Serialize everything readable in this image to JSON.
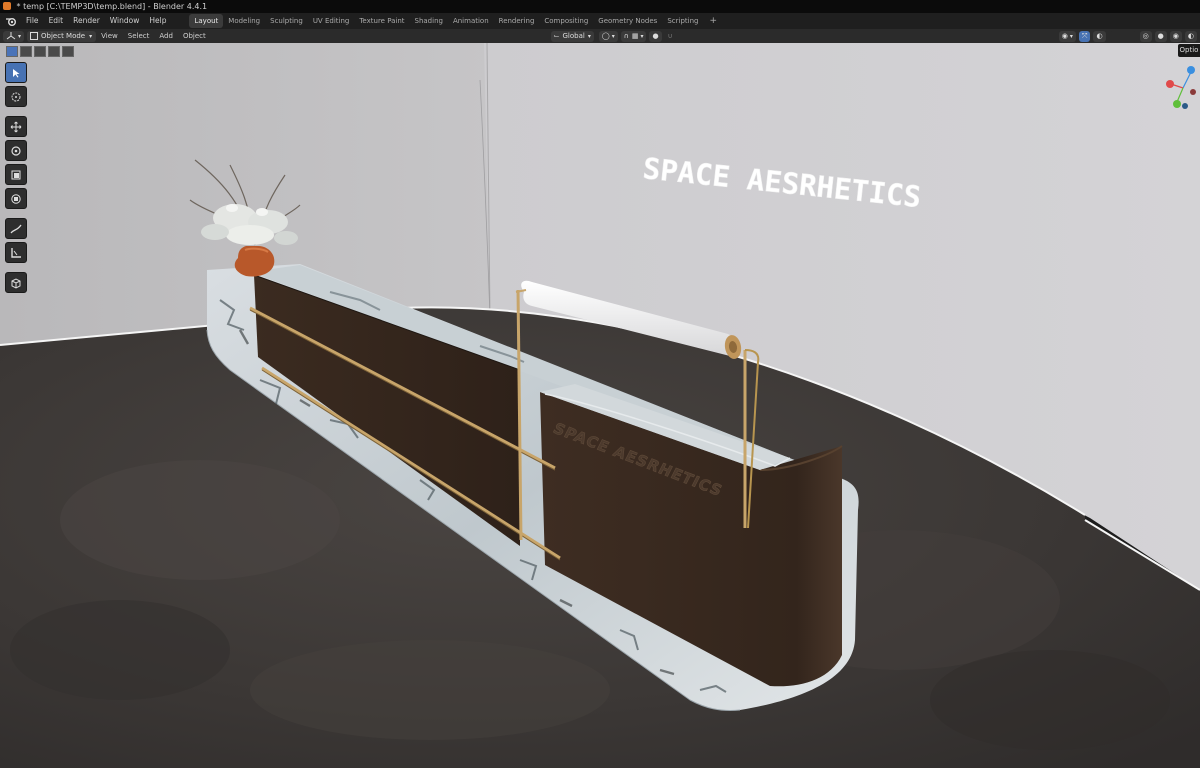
{
  "window": {
    "title": "* temp [C:\\TEMP3D\\temp.blend] - Blender 4.4.1"
  },
  "menu": [
    "File",
    "Edit",
    "Render",
    "Window",
    "Help"
  ],
  "workspaces": [
    "Layout",
    "Modeling",
    "Sculpting",
    "UV Editing",
    "Texture Paint",
    "Shading",
    "Animation",
    "Rendering",
    "Compositing",
    "Geometry Nodes",
    "Scripting"
  ],
  "active_workspace": "Layout",
  "header": {
    "mode": "Object Mode",
    "menus": [
      "View",
      "Select",
      "Add",
      "Object"
    ],
    "transform_orientation": "Global",
    "options_label": "Optio"
  },
  "tools": [
    "select-box",
    "cursor",
    "move",
    "rotate",
    "scale",
    "transform",
    "annotate",
    "measure",
    "add-cube"
  ],
  "scene": {
    "wall_text": "SPACE AESRHETICS",
    "desk_panel_text": "SPACE AESRHETICS"
  },
  "colors": {
    "accent": "#4772b3",
    "wall": "#cfcfd1",
    "floor": "#3f3b39",
    "panel": "#3a2a1f",
    "brass": "#c8a56a",
    "vase": "#b8582a"
  }
}
